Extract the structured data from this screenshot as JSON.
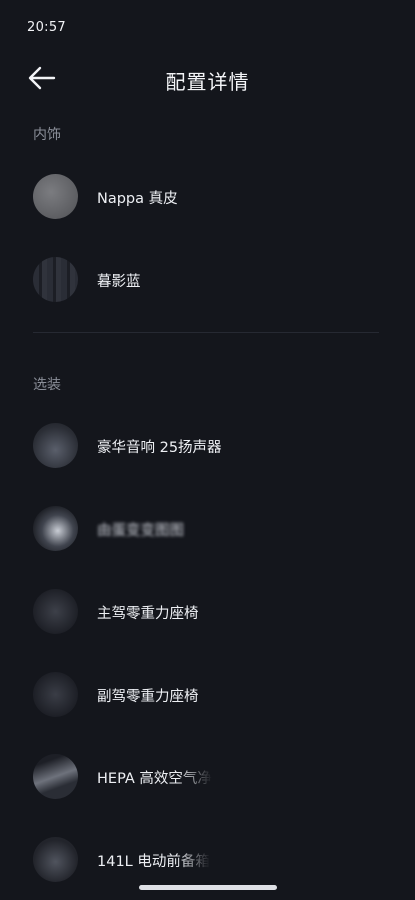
{
  "status_bar": {
    "time": "20:57"
  },
  "header": {
    "back_icon": "arrow-left-icon",
    "title": "配置详情"
  },
  "sections": {
    "interior": {
      "title": "内饰",
      "items": [
        {
          "label": "Nappa 真皮",
          "thumbnail": "nappa-leather-swatch"
        },
        {
          "label": "暮影蓝",
          "thumbnail": "dusk-blue-trim-swatch"
        }
      ]
    },
    "options": {
      "title": "选装",
      "items": [
        {
          "label": "豪华音响 25扬声器",
          "thumbnail": "speaker-photo"
        },
        {
          "label": "由蛋变变图图",
          "thumbnail": "rear-screen-photo",
          "blurred": true
        },
        {
          "label": "主驾零重力座椅",
          "thumbnail": "driver-seat-photo"
        },
        {
          "label": "副驾零重力座椅",
          "thumbnail": "passenger-seat-photo"
        },
        {
          "label": "HEPA 高效空气净",
          "thumbnail": "air-filter-photo"
        },
        {
          "label": "141L 电动前备箱",
          "thumbnail": "front-trunk-photo"
        }
      ]
    }
  }
}
